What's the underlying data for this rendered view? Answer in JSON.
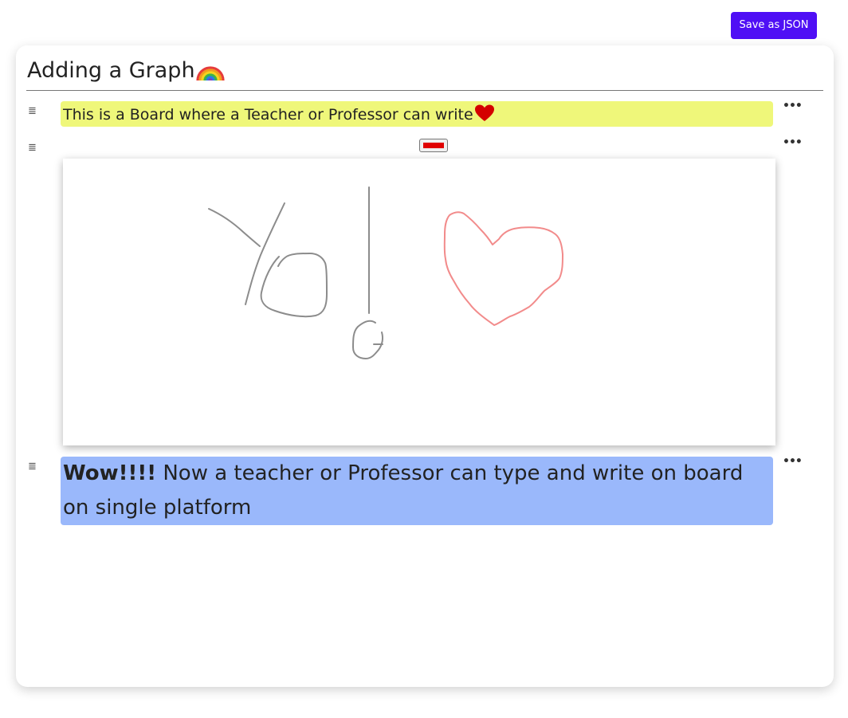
{
  "toolbar": {
    "save_label": "Save as JSON",
    "accent": "#4f0ff5"
  },
  "page": {
    "title": "Adding a Graph",
    "title_emoji": "rainbow-icon"
  },
  "blocks": [
    {
      "type": "text",
      "text": "This is a Board where a Teacher or Professor can write",
      "emoji": "heart-icon",
      "background": "#eff77a"
    },
    {
      "type": "drawing",
      "pen_color": "#e00000",
      "strokes": {
        "gray": "#8c8c8c",
        "red": "#f28b8b"
      }
    },
    {
      "type": "text",
      "bold": "Wow!!!!",
      "text": " Now a teacher or Professor can type and write on board on single platform",
      "background": "#9ab8fb"
    }
  ],
  "icons": {
    "handle": "≣",
    "more": "•••"
  }
}
